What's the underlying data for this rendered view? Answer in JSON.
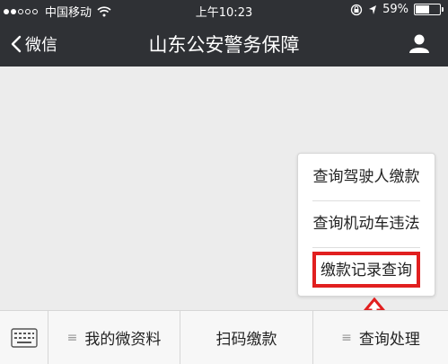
{
  "status_bar": {
    "carrier": "中国移动",
    "time": "上午10:23",
    "battery": "59%",
    "battery_level": 0.59
  },
  "nav": {
    "back_label": "微信",
    "title": "山东公安警务保障"
  },
  "popup_menu": {
    "items": [
      "查询驾驶人缴款",
      "查询机动车违法",
      "缴款记录查询"
    ],
    "highlighted_index": 2,
    "highlight_color": "#e11f1f"
  },
  "bottom_bar": {
    "tabs": [
      "我的微资料",
      "扫码缴款",
      "查询处理"
    ]
  },
  "icons": {
    "back": "chevron-left-icon",
    "user": "user-icon",
    "keyboard": "keyboard-icon",
    "wifi": "wifi-icon",
    "lock": "rotation-lock-icon",
    "location": "location-arrow-icon",
    "battery": "battery-icon",
    "menu": "hamburger-icon",
    "arrow": "up-arrow-icon"
  }
}
